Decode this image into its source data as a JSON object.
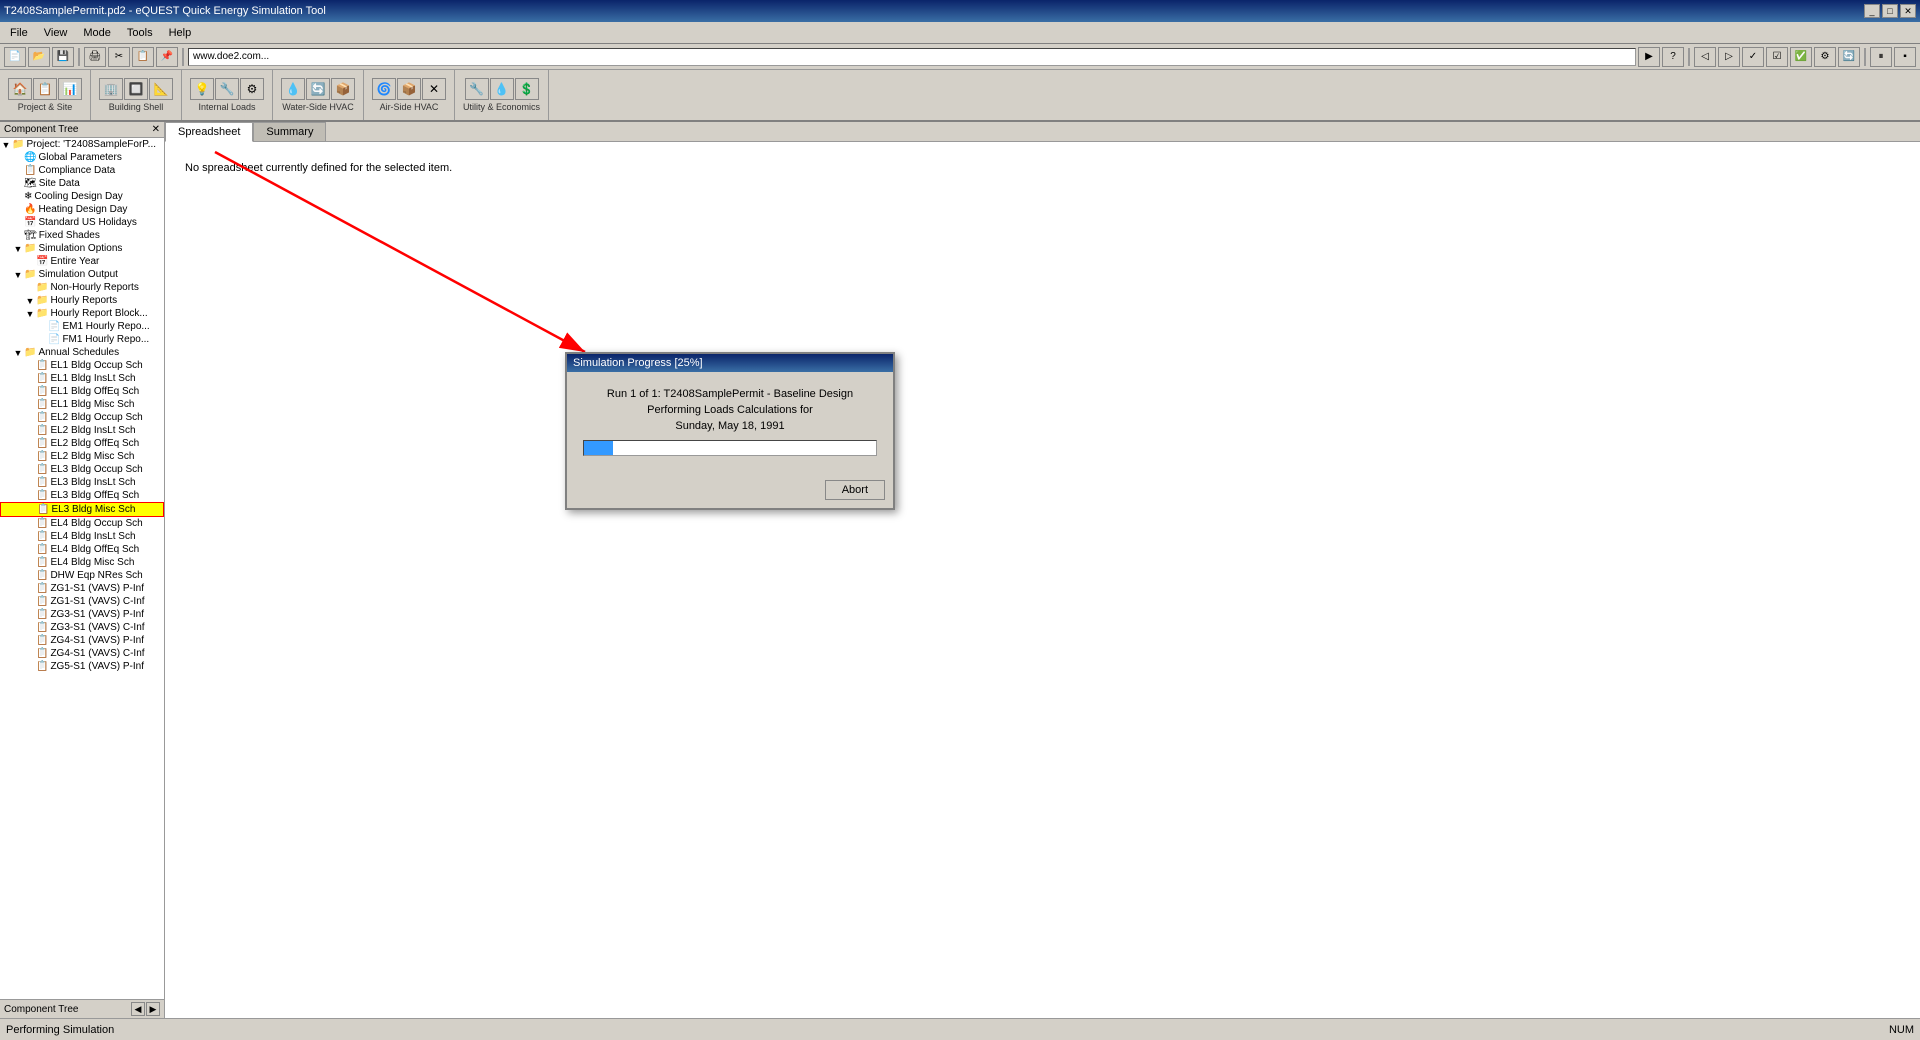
{
  "titleBar": {
    "title": "T2408SamplePermit.pd2 - eQUEST Quick Energy Simulation Tool",
    "controls": [
      "_",
      "□",
      "✕"
    ]
  },
  "menuBar": {
    "items": [
      "File",
      "View",
      "Mode",
      "Tools",
      "Help"
    ]
  },
  "mainToolbar": {
    "groups": [
      {
        "label": "Project & Site",
        "buttons": [
          "🏠",
          "📋",
          "📊"
        ]
      },
      {
        "label": "Building Shell",
        "buttons": [
          "🏢",
          "🔲",
          "📐"
        ]
      },
      {
        "label": "Internal Loads",
        "buttons": [
          "💡",
          "🔧",
          "⚙"
        ]
      },
      {
        "label": "Water-Side HVAC",
        "buttons": [
          "💧",
          "🔄",
          "📦"
        ]
      },
      {
        "label": "Air-Side HVAC",
        "buttons": [
          "🌀",
          "📦",
          "✕"
        ]
      },
      {
        "label": "Utility & Economics",
        "buttons": [
          "🔧",
          "💧",
          "💲"
        ]
      }
    ]
  },
  "leftPanel": {
    "header": "Component Tree",
    "closeLabel": "✕",
    "treeItems": [
      {
        "id": "project",
        "label": "Project: 'T2408SampleForP...",
        "level": 0,
        "icon": "📁",
        "expanded": true
      },
      {
        "id": "global",
        "label": "Global Parameters",
        "level": 1,
        "icon": "🌐"
      },
      {
        "id": "compliance",
        "label": "Compliance Data",
        "level": 1,
        "icon": "📋"
      },
      {
        "id": "site",
        "label": "Site Data",
        "level": 1,
        "icon": "🗺"
      },
      {
        "id": "cooling",
        "label": "Cooling Design Day",
        "level": 1,
        "icon": "❄"
      },
      {
        "id": "heating",
        "label": "Heating Design Day",
        "level": 1,
        "icon": "🔥"
      },
      {
        "id": "holidays",
        "label": "Standard US Holidays",
        "level": 1,
        "icon": "📅"
      },
      {
        "id": "shades",
        "label": "Fixed Shades",
        "level": 1,
        "icon": "🏗"
      },
      {
        "id": "simoptions",
        "label": "Simulation Options",
        "level": 1,
        "icon": "📁",
        "expanded": true
      },
      {
        "id": "entireyear",
        "label": "Entire Year",
        "level": 2,
        "icon": "📅"
      },
      {
        "id": "simoutput",
        "label": "Simulation Output",
        "level": 1,
        "icon": "📁",
        "expanded": true
      },
      {
        "id": "nonhourly",
        "label": "Non-Hourly Reports",
        "level": 2,
        "icon": "📁"
      },
      {
        "id": "hourlyreports",
        "label": "Hourly Reports",
        "level": 2,
        "icon": "📁",
        "expanded": true
      },
      {
        "id": "hourlyblock",
        "label": "Hourly Report Block...",
        "level": 2,
        "icon": "📁",
        "expanded": true
      },
      {
        "id": "em1",
        "label": "EM1 Hourly Repo...",
        "level": 3,
        "icon": "📄"
      },
      {
        "id": "fm1",
        "label": "FM1 Hourly Repo...",
        "level": 3,
        "icon": "📄"
      },
      {
        "id": "annualsched",
        "label": "Annual Schedules",
        "level": 1,
        "icon": "📁",
        "expanded": true
      },
      {
        "id": "el1occup",
        "label": "EL1 Bldg Occup Sch",
        "level": 2,
        "icon": "📋"
      },
      {
        "id": "el1inslt",
        "label": "EL1 Bldg InsLt Sch",
        "level": 2,
        "icon": "📋"
      },
      {
        "id": "el1offeq",
        "label": "EL1 Bldg OffEq Sch",
        "level": 2,
        "icon": "📋"
      },
      {
        "id": "el1misc",
        "label": "EL1 Bldg Misc Sch",
        "level": 2,
        "icon": "📋"
      },
      {
        "id": "el2occup",
        "label": "EL2 Bldg Occup Sch",
        "level": 2,
        "icon": "📋"
      },
      {
        "id": "el2inslt",
        "label": "EL2 Bldg InsLt Sch",
        "level": 2,
        "icon": "📋"
      },
      {
        "id": "el2offeq",
        "label": "EL2 Bldg OffEq Sch",
        "level": 2,
        "icon": "📋"
      },
      {
        "id": "el2misc",
        "label": "EL2 Bldg Misc Sch",
        "level": 2,
        "icon": "📋"
      },
      {
        "id": "el3occup",
        "label": "EL3 Bldg Occup Sch",
        "level": 2,
        "icon": "📋"
      },
      {
        "id": "el3inslt",
        "label": "EL3 Bldg InsLt Sch",
        "level": 2,
        "icon": "📋"
      },
      {
        "id": "el3offeq",
        "label": "EL3 Bldg OffEq Sch",
        "level": 2,
        "icon": "📋"
      },
      {
        "id": "el3misc",
        "label": "EL3 Bldg Misc Sch",
        "level": 2,
        "icon": "📋",
        "highlighted": true
      },
      {
        "id": "el4occup",
        "label": "EL4 Bldg Occup Sch",
        "level": 2,
        "icon": "📋"
      },
      {
        "id": "el4inslt",
        "label": "EL4 Bldg InsLt Sch",
        "level": 2,
        "icon": "📋"
      },
      {
        "id": "el4offeq",
        "label": "EL4 Bldg OffEq Sch",
        "level": 2,
        "icon": "📋"
      },
      {
        "id": "el4misc",
        "label": "EL4 Bldg Misc Sch",
        "level": 2,
        "icon": "📋"
      },
      {
        "id": "dhw",
        "label": "DHW Eqp NRes Sch",
        "level": 2,
        "icon": "📋"
      },
      {
        "id": "zg1p",
        "label": "ZG1-S1 (VAVS) P-Inf",
        "level": 2,
        "icon": "📋"
      },
      {
        "id": "zg1c",
        "label": "ZG1-S1 (VAVS) C-Inf",
        "level": 2,
        "icon": "📋"
      },
      {
        "id": "zg3p",
        "label": "ZG3-S1 (VAVS) P-Inf",
        "level": 2,
        "icon": "📋"
      },
      {
        "id": "zg3c",
        "label": "ZG3-S1 (VAVS) C-Inf",
        "level": 2,
        "icon": "📋"
      },
      {
        "id": "zg4p",
        "label": "ZG4-S1 (VAVS) P-Inf",
        "level": 2,
        "icon": "📋"
      },
      {
        "id": "zg4c",
        "label": "ZG4-S1 (VAVS) C-Inf",
        "level": 2,
        "icon": "📋"
      },
      {
        "id": "zg5p",
        "label": "ZG5-S1 (VAVS) P-Inf",
        "level": 2,
        "icon": "📋"
      }
    ]
  },
  "tabs": [
    {
      "id": "spreadsheet",
      "label": "Spreadsheet",
      "active": true
    },
    {
      "id": "summary",
      "label": "Summary",
      "active": false
    }
  ],
  "mainContent": {
    "noSpreadsheetText": "No spreadsheet currently defined for the selected item."
  },
  "simulationDialog": {
    "title": "Simulation Progress [25%]",
    "line1": "Run 1 of 1:  T2408SamplePermit - Baseline Design",
    "line2": "Performing Loads Calculations for",
    "line3": "Sunday, May 18, 1991",
    "progressPercent": 10,
    "abortButton": "Abort"
  },
  "statusBar": {
    "leftText": "Performing Simulation",
    "rightText": "NUM"
  }
}
